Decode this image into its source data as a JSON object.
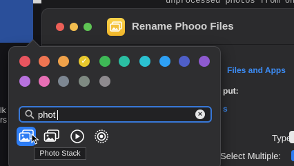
{
  "background": {
    "top_right_text": "unprocessed  photos  from  one",
    "sidebar_lines": [
      "lk",
      "rs"
    ]
  },
  "window": {
    "title": "Rename Phooo Files",
    "files_and_apps_label": "Files and Apps",
    "output_label": "put:",
    "s_label": "s",
    "type_label": "Type:",
    "select_multiple_label": "Select Multiple:"
  },
  "popover": {
    "colors": [
      "#e8555f",
      "#ef7552",
      "#f0a24a",
      "#e9c92d",
      "#3eb956",
      "#2bbfa3",
      "#2bc1d1",
      "#2ea0f5",
      "#4f5fc8",
      "#8e5ad0",
      "#b772de",
      "#e76fb5",
      "#7d8792",
      "#7f8a82",
      "#8e8a8e"
    ],
    "selected_color_index": 3,
    "selected_check": "✓",
    "search": {
      "value": "phot",
      "clear_label": "×"
    },
    "results": [
      {
        "name": "photo-stack-icon",
        "selected": true
      },
      {
        "name": "photo-icon",
        "selected": false
      },
      {
        "name": "play-circle-icon",
        "selected": false
      },
      {
        "name": "target-circle-icon",
        "selected": false
      }
    ],
    "tooltip": "Photo Stack"
  }
}
